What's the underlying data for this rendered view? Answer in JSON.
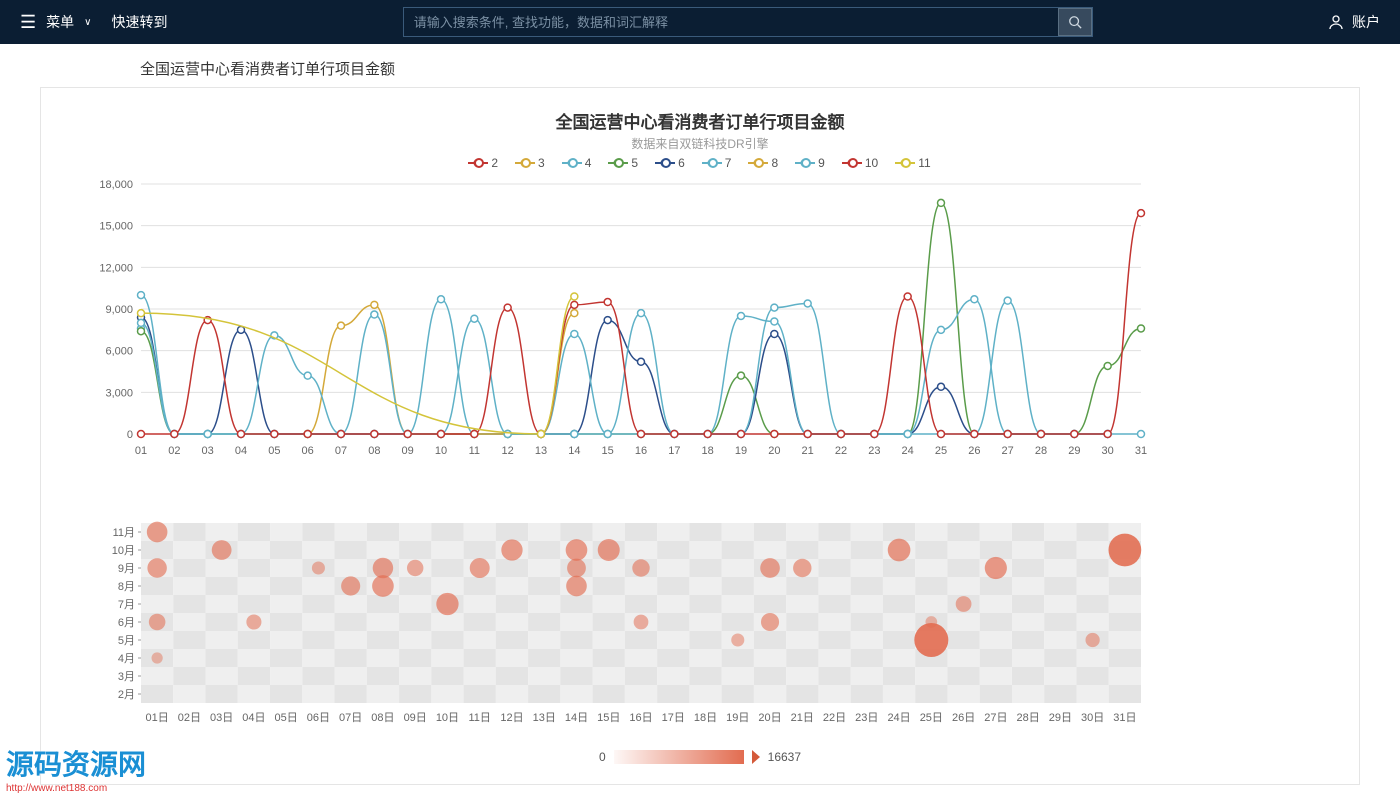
{
  "header": {
    "menu": "菜单",
    "jump": "快速转到",
    "search_placeholder": "请输入搜索条件, 查找功能，数据和词汇解释",
    "account": "账户"
  },
  "page_title": "全国运营中心看消费者订单行项目金额",
  "chart_data": [
    {
      "type": "line",
      "title": "全国运营中心看消费者订单行项目金额",
      "subtitle": "数据来自双链科技DR引擎",
      "xlabel": "",
      "ylabel": "",
      "ylim": [
        0,
        18000
      ],
      "yticks": [
        0,
        3000,
        6000,
        9000,
        12000,
        15000,
        18000
      ],
      "categories": [
        "01",
        "02",
        "03",
        "04",
        "05",
        "06",
        "07",
        "08",
        "09",
        "10",
        "11",
        "12",
        "13",
        "14",
        "15",
        "16",
        "17",
        "18",
        "19",
        "20",
        "21",
        "22",
        "23",
        "24",
        "25",
        "26",
        "27",
        "28",
        "29",
        "30",
        "31"
      ],
      "legend_labels": [
        "2",
        "3",
        "4",
        "5",
        "6",
        "7",
        "8",
        "9",
        "10",
        "11"
      ],
      "colors": {
        "2": "#c23531",
        "3": "#d4a93a",
        "4": "#5fb1c7",
        "5": "#5a9c4a",
        "6": "#2c4e8a",
        "7": "#5fb1c7",
        "8": "#d4a93a",
        "9": "#5fb1c7",
        "10": "#c23531",
        "11": "#d4c43a"
      },
      "series": [
        {
          "name": "2",
          "points": []
        },
        {
          "name": "3",
          "points": []
        },
        {
          "name": "4",
          "points": [
            {
              "x": 1,
              "y": 7600
            }
          ]
        },
        {
          "name": "5",
          "points": [
            {
              "x": 1,
              "y": 7400
            },
            {
              "x": 2,
              "y": 0
            },
            {
              "x": 3,
              "y": 0
            },
            {
              "x": 4,
              "y": 0
            },
            {
              "x": 5,
              "y": 0
            },
            {
              "x": 6,
              "y": 0
            },
            {
              "x": 7,
              "y": 0
            },
            {
              "x": 8,
              "y": 0
            },
            {
              "x": 9,
              "y": 0
            },
            {
              "x": 10,
              "y": 0
            },
            {
              "x": 11,
              "y": 0
            },
            {
              "x": 12,
              "y": 0
            },
            {
              "x": 13,
              "y": 0
            },
            {
              "x": 14,
              "y": 0
            },
            {
              "x": 15,
              "y": 0
            },
            {
              "x": 16,
              "y": 0
            },
            {
              "x": 17,
              "y": 0
            },
            {
              "x": 18,
              "y": 0
            },
            {
              "x": 19,
              "y": 4200
            },
            {
              "x": 20,
              "y": 0
            },
            {
              "x": 21,
              "y": 0
            },
            {
              "x": 22,
              "y": 0
            },
            {
              "x": 23,
              "y": 0
            },
            {
              "x": 24,
              "y": 0
            },
            {
              "x": 25,
              "y": 16637
            },
            {
              "x": 26,
              "y": 0
            },
            {
              "x": 27,
              "y": 0
            },
            {
              "x": 28,
              "y": 0
            },
            {
              "x": 29,
              "y": 0
            },
            {
              "x": 30,
              "y": 4900
            },
            {
              "x": 31,
              "y": 7600
            }
          ]
        },
        {
          "name": "6",
          "points": [
            {
              "x": 1,
              "y": 8400
            },
            {
              "x": 2,
              "y": 0
            },
            {
              "x": 3,
              "y": 0
            },
            {
              "x": 4,
              "y": 7500
            },
            {
              "x": 5,
              "y": 0
            },
            {
              "x": 6,
              "y": 0
            },
            {
              "x": 7,
              "y": 0
            },
            {
              "x": 8,
              "y": 0
            },
            {
              "x": 9,
              "y": 0
            },
            {
              "x": 10,
              "y": 0
            },
            {
              "x": 11,
              "y": 0
            },
            {
              "x": 12,
              "y": 0
            },
            {
              "x": 13,
              "y": 0
            },
            {
              "x": 14,
              "y": 0
            },
            {
              "x": 15,
              "y": 8200
            },
            {
              "x": 16,
              "y": 5200
            },
            {
              "x": 17,
              "y": 0
            },
            {
              "x": 18,
              "y": 0
            },
            {
              "x": 19,
              "y": 0
            },
            {
              "x": 20,
              "y": 7200
            },
            {
              "x": 21,
              "y": 0
            },
            {
              "x": 22,
              "y": 0
            },
            {
              "x": 23,
              "y": 0
            },
            {
              "x": 24,
              "y": 0
            },
            {
              "x": 25,
              "y": 3400
            },
            {
              "x": 26,
              "y": 0
            },
            {
              "x": 27,
              "y": 0
            },
            {
              "x": 28,
              "y": 0
            },
            {
              "x": 29,
              "y": 0
            },
            {
              "x": 30,
              "y": 0
            }
          ]
        },
        {
          "name": "7",
          "points": [
            {
              "x": 1,
              "y": 10000
            },
            {
              "x": 2,
              "y": 0
            },
            {
              "x": 3,
              "y": 0
            },
            {
              "x": 4,
              "y": 0
            },
            {
              "x": 5,
              "y": 0
            },
            {
              "x": 6,
              "y": 0
            },
            {
              "x": 7,
              "y": 0
            },
            {
              "x": 8,
              "y": 0
            },
            {
              "x": 9,
              "y": 0
            },
            {
              "x": 10,
              "y": 9700
            },
            {
              "x": 11,
              "y": 0
            },
            {
              "x": 12,
              "y": 0
            },
            {
              "x": 13,
              "y": 0
            },
            {
              "x": 14,
              "y": 7200
            },
            {
              "x": 15,
              "y": 0
            },
            {
              "x": 16,
              "y": 8700
            },
            {
              "x": 17,
              "y": 0
            },
            {
              "x": 18,
              "y": 0
            },
            {
              "x": 19,
              "y": 0
            },
            {
              "x": 20,
              "y": 9100
            },
            {
              "x": 21,
              "y": 9400
            },
            {
              "x": 22,
              "y": 0
            },
            {
              "x": 23,
              "y": 0
            },
            {
              "x": 24,
              "y": 0
            },
            {
              "x": 25,
              "y": 7500
            },
            {
              "x": 26,
              "y": 9700
            },
            {
              "x": 27,
              "y": 0
            },
            {
              "x": 28,
              "y": 0
            },
            {
              "x": 29,
              "y": 0
            },
            {
              "x": 30,
              "y": 0
            },
            {
              "x": 31,
              "y": 0
            }
          ]
        },
        {
          "name": "8",
          "points": [
            {
              "x": 6,
              "y": 0
            },
            {
              "x": 7,
              "y": 7800
            },
            {
              "x": 8,
              "y": 9300
            },
            {
              "x": 9,
              "y": 0
            },
            {
              "x": 10,
              "y": 0
            },
            {
              "x": 11,
              "y": 0
            },
            {
              "x": 12,
              "y": 0
            },
            {
              "x": 13,
              "y": 0
            },
            {
              "x": 14,
              "y": 8700
            }
          ]
        },
        {
          "name": "9",
          "points": [
            {
              "x": 1,
              "y": 8000
            },
            {
              "x": 2,
              "y": 0
            },
            {
              "x": 3,
              "y": 0
            },
            {
              "x": 4,
              "y": 0
            },
            {
              "x": 5,
              "y": 7100
            },
            {
              "x": 6,
              "y": 4200
            },
            {
              "x": 7,
              "y": 0
            },
            {
              "x": 8,
              "y": 8600
            },
            {
              "x": 9,
              "y": 0
            },
            {
              "x": 10,
              "y": 0
            },
            {
              "x": 11,
              "y": 8300
            },
            {
              "x": 12,
              "y": 0
            },
            {
              "x": 13,
              "y": 0
            },
            {
              "x": 14,
              "y": 0
            },
            {
              "x": 15,
              "y": 0
            },
            {
              "x": 16,
              "y": 0
            },
            {
              "x": 17,
              "y": 0
            },
            {
              "x": 18,
              "y": 0
            },
            {
              "x": 19,
              "y": 8500
            },
            {
              "x": 20,
              "y": 8100
            },
            {
              "x": 21,
              "y": 0
            },
            {
              "x": 22,
              "y": 0
            },
            {
              "x": 23,
              "y": 0
            },
            {
              "x": 24,
              "y": 0
            },
            {
              "x": 25,
              "y": 0
            },
            {
              "x": 26,
              "y": 0
            },
            {
              "x": 27,
              "y": 9600
            },
            {
              "x": 28,
              "y": 0
            },
            {
              "x": 29,
              "y": 0
            },
            {
              "x": 30,
              "y": 0
            }
          ]
        },
        {
          "name": "10",
          "points": [
            {
              "x": 1,
              "y": 0
            },
            {
              "x": 2,
              "y": 0
            },
            {
              "x": 3,
              "y": 8200
            },
            {
              "x": 4,
              "y": 0
            },
            {
              "x": 5,
              "y": 0
            },
            {
              "x": 6,
              "y": 0
            },
            {
              "x": 7,
              "y": 0
            },
            {
              "x": 8,
              "y": 0
            },
            {
              "x": 9,
              "y": 0
            },
            {
              "x": 10,
              "y": 0
            },
            {
              "x": 11,
              "y": 0
            },
            {
              "x": 12,
              "y": 9100
            },
            {
              "x": 13,
              "y": 0
            },
            {
              "x": 14,
              "y": 9300
            },
            {
              "x": 15,
              "y": 9500
            },
            {
              "x": 16,
              "y": 0
            },
            {
              "x": 17,
              "y": 0
            },
            {
              "x": 18,
              "y": 0
            },
            {
              "x": 19,
              "y": 0
            },
            {
              "x": 20,
              "y": 0
            },
            {
              "x": 21,
              "y": 0
            },
            {
              "x": 22,
              "y": 0
            },
            {
              "x": 23,
              "y": 0
            },
            {
              "x": 24,
              "y": 9900
            },
            {
              "x": 25,
              "y": 0
            },
            {
              "x": 26,
              "y": 0
            },
            {
              "x": 27,
              "y": 0
            },
            {
              "x": 28,
              "y": 0
            },
            {
              "x": 29,
              "y": 0
            },
            {
              "x": 30,
              "y": 0
            },
            {
              "x": 31,
              "y": 15900
            }
          ]
        },
        {
          "name": "11",
          "points": [
            {
              "x": 1,
              "y": 8700
            },
            {
              "x": 13,
              "y": 0
            },
            {
              "x": 14,
              "y": 9900
            }
          ]
        }
      ]
    },
    {
      "type": "scatter",
      "x_categories": [
        "01日",
        "02日",
        "03日",
        "04日",
        "05日",
        "06日",
        "07日",
        "08日",
        "09日",
        "10日",
        "11日",
        "12日",
        "13日",
        "14日",
        "15日",
        "16日",
        "17日",
        "18日",
        "19日",
        "20日",
        "21日",
        "22日",
        "23日",
        "24日",
        "25日",
        "26日",
        "27日",
        "28日",
        "29日",
        "30日",
        "31日"
      ],
      "y_categories": [
        "2月",
        "3月",
        "4月",
        "5月",
        "6月",
        "7月",
        "8月",
        "9月",
        "10月",
        "11月"
      ],
      "color_min": 0,
      "color_max": 16637,
      "points": [
        {
          "x": 1,
          "y": "11月",
          "v": 8700
        },
        {
          "x": 3,
          "y": "10月",
          "v": 8200
        },
        {
          "x": 12,
          "y": "10月",
          "v": 9100
        },
        {
          "x": 14,
          "y": "10月",
          "v": 9300
        },
        {
          "x": 15,
          "y": "10月",
          "v": 9500
        },
        {
          "x": 24,
          "y": "10月",
          "v": 9900
        },
        {
          "x": 31,
          "y": "10月",
          "v": 15900
        },
        {
          "x": 1,
          "y": "9月",
          "v": 8000
        },
        {
          "x": 6,
          "y": "9月",
          "v": 4200
        },
        {
          "x": 8,
          "y": "9月",
          "v": 8600
        },
        {
          "x": 9,
          "y": "9月",
          "v": 6200
        },
        {
          "x": 11,
          "y": "9月",
          "v": 8300
        },
        {
          "x": 14,
          "y": "9月",
          "v": 7600
        },
        {
          "x": 16,
          "y": "9月",
          "v": 6800
        },
        {
          "x": 20,
          "y": "9月",
          "v": 8100
        },
        {
          "x": 21,
          "y": "9月",
          "v": 7400
        },
        {
          "x": 27,
          "y": "9月",
          "v": 9600
        },
        {
          "x": 7,
          "y": "8月",
          "v": 7800
        },
        {
          "x": 8,
          "y": "8月",
          "v": 9300
        },
        {
          "x": 14,
          "y": "8月",
          "v": 8700
        },
        {
          "x": 10,
          "y": "7月",
          "v": 9700
        },
        {
          "x": 26,
          "y": "7月",
          "v": 5800
        },
        {
          "x": 1,
          "y": "6月",
          "v": 6300
        },
        {
          "x": 4,
          "y": "6月",
          "v": 5400
        },
        {
          "x": 16,
          "y": "6月",
          "v": 5200
        },
        {
          "x": 20,
          "y": "6月",
          "v": 7200
        },
        {
          "x": 25,
          "y": "6月",
          "v": 3400
        },
        {
          "x": 19,
          "y": "5月",
          "v": 4200
        },
        {
          "x": 25,
          "y": "5月",
          "v": 16637
        },
        {
          "x": 30,
          "y": "5月",
          "v": 4900
        },
        {
          "x": 1,
          "y": "4月",
          "v": 3100
        }
      ]
    }
  ],
  "scale": {
    "min": "0",
    "max": "16637"
  },
  "watermark": {
    "cn": "源码资源网",
    "url": "http://www.net188.com"
  }
}
